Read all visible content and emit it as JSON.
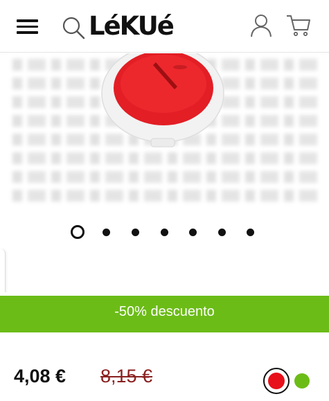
{
  "header": {
    "brand": "LéKUé",
    "icons": {
      "menu": "hamburger-menu-icon",
      "search": "search-icon",
      "account": "user-icon",
      "cart": "cart-icon"
    }
  },
  "gallery": {
    "slide_count": 7,
    "active_slide": 1
  },
  "promo": {
    "label": "-50% descuento",
    "color": "#6cbc17"
  },
  "pricing": {
    "price": "4,08 €",
    "old_price": "8,15 €"
  },
  "colors": {
    "options": [
      "#e8101a",
      "#6cbc17"
    ],
    "selected": "#e8101a"
  }
}
